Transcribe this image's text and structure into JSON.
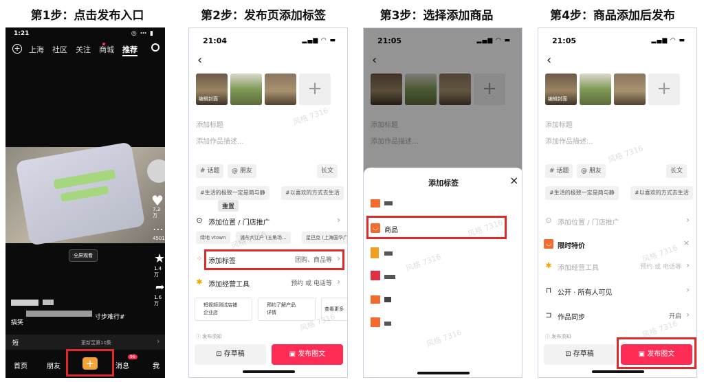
{
  "steps": [
    {
      "title": "第1步：点击发布入口"
    },
    {
      "title": "第2步：发布页添加标签"
    },
    {
      "title": "第3步：选择添加商品"
    },
    {
      "title": "第4步：商品添加后发布"
    }
  ],
  "watermark": "风格 7316",
  "phone1": {
    "time": "1:21",
    "status_icons": "◎ ⋯ ▮",
    "tabs": [
      "上海",
      "社区",
      "关注",
      "商城",
      "推荐"
    ],
    "fullscreen_btn": "全屏观看",
    "like_count": "7.3万",
    "comment_count": "4501",
    "fav_count": "1.4万",
    "share_count": "1.6万",
    "caption_tail": "寸步难行#",
    "caption_left": "搞笑",
    "bar_left": "短",
    "bar_mid": "更新至第10集",
    "nav": [
      "首页",
      "朋友",
      "消息",
      "我"
    ],
    "msg_badge": "96"
  },
  "form": {
    "time2": "21:04",
    "time3": "21:05",
    "time4": "21:05",
    "status_icons": "▂▄▆ ◠ ▬",
    "edit_label": "编辑封面",
    "title_placeholder": "添加标题",
    "desc_placeholder": "添加作品描述...",
    "topic_chip": "# 话题",
    "friend_chip": "@ 朋友",
    "long_text_chip": "长文",
    "hashtag1": "#生活的极致一定是简与静",
    "hashtag2": "#以喜欢的方式去生活",
    "reset_tooltip": "重置",
    "location_label": "添加位置 / 门店推广",
    "loc_chips": [
      "绿地 vtown",
      "浦东大江户 (五角场...",
      "星巴克 (上海国华广..."
    ],
    "tag_label": "添加标签",
    "tag_value": "团购、商品等",
    "tools_label": "添加经营工具",
    "tools_value": "预约 或 电话等",
    "card1_line1": "短视频测试店铺",
    "card1_line2": "企业店",
    "card2_line1": "预约了解产品",
    "card2_line2": "详情",
    "see_more": "查看更多",
    "publish_notice": "发布须知",
    "draft_btn": "存草稿",
    "publish_btn": "发布图文"
  },
  "tag_sheet": {
    "title": "添加标签",
    "close": "×",
    "product_option": "商品"
  },
  "phone4": {
    "flash_sale": "限时特价",
    "visibility": "公开 · 所有人可见",
    "sync_label": "作品同步",
    "sync_value": "开启"
  }
}
